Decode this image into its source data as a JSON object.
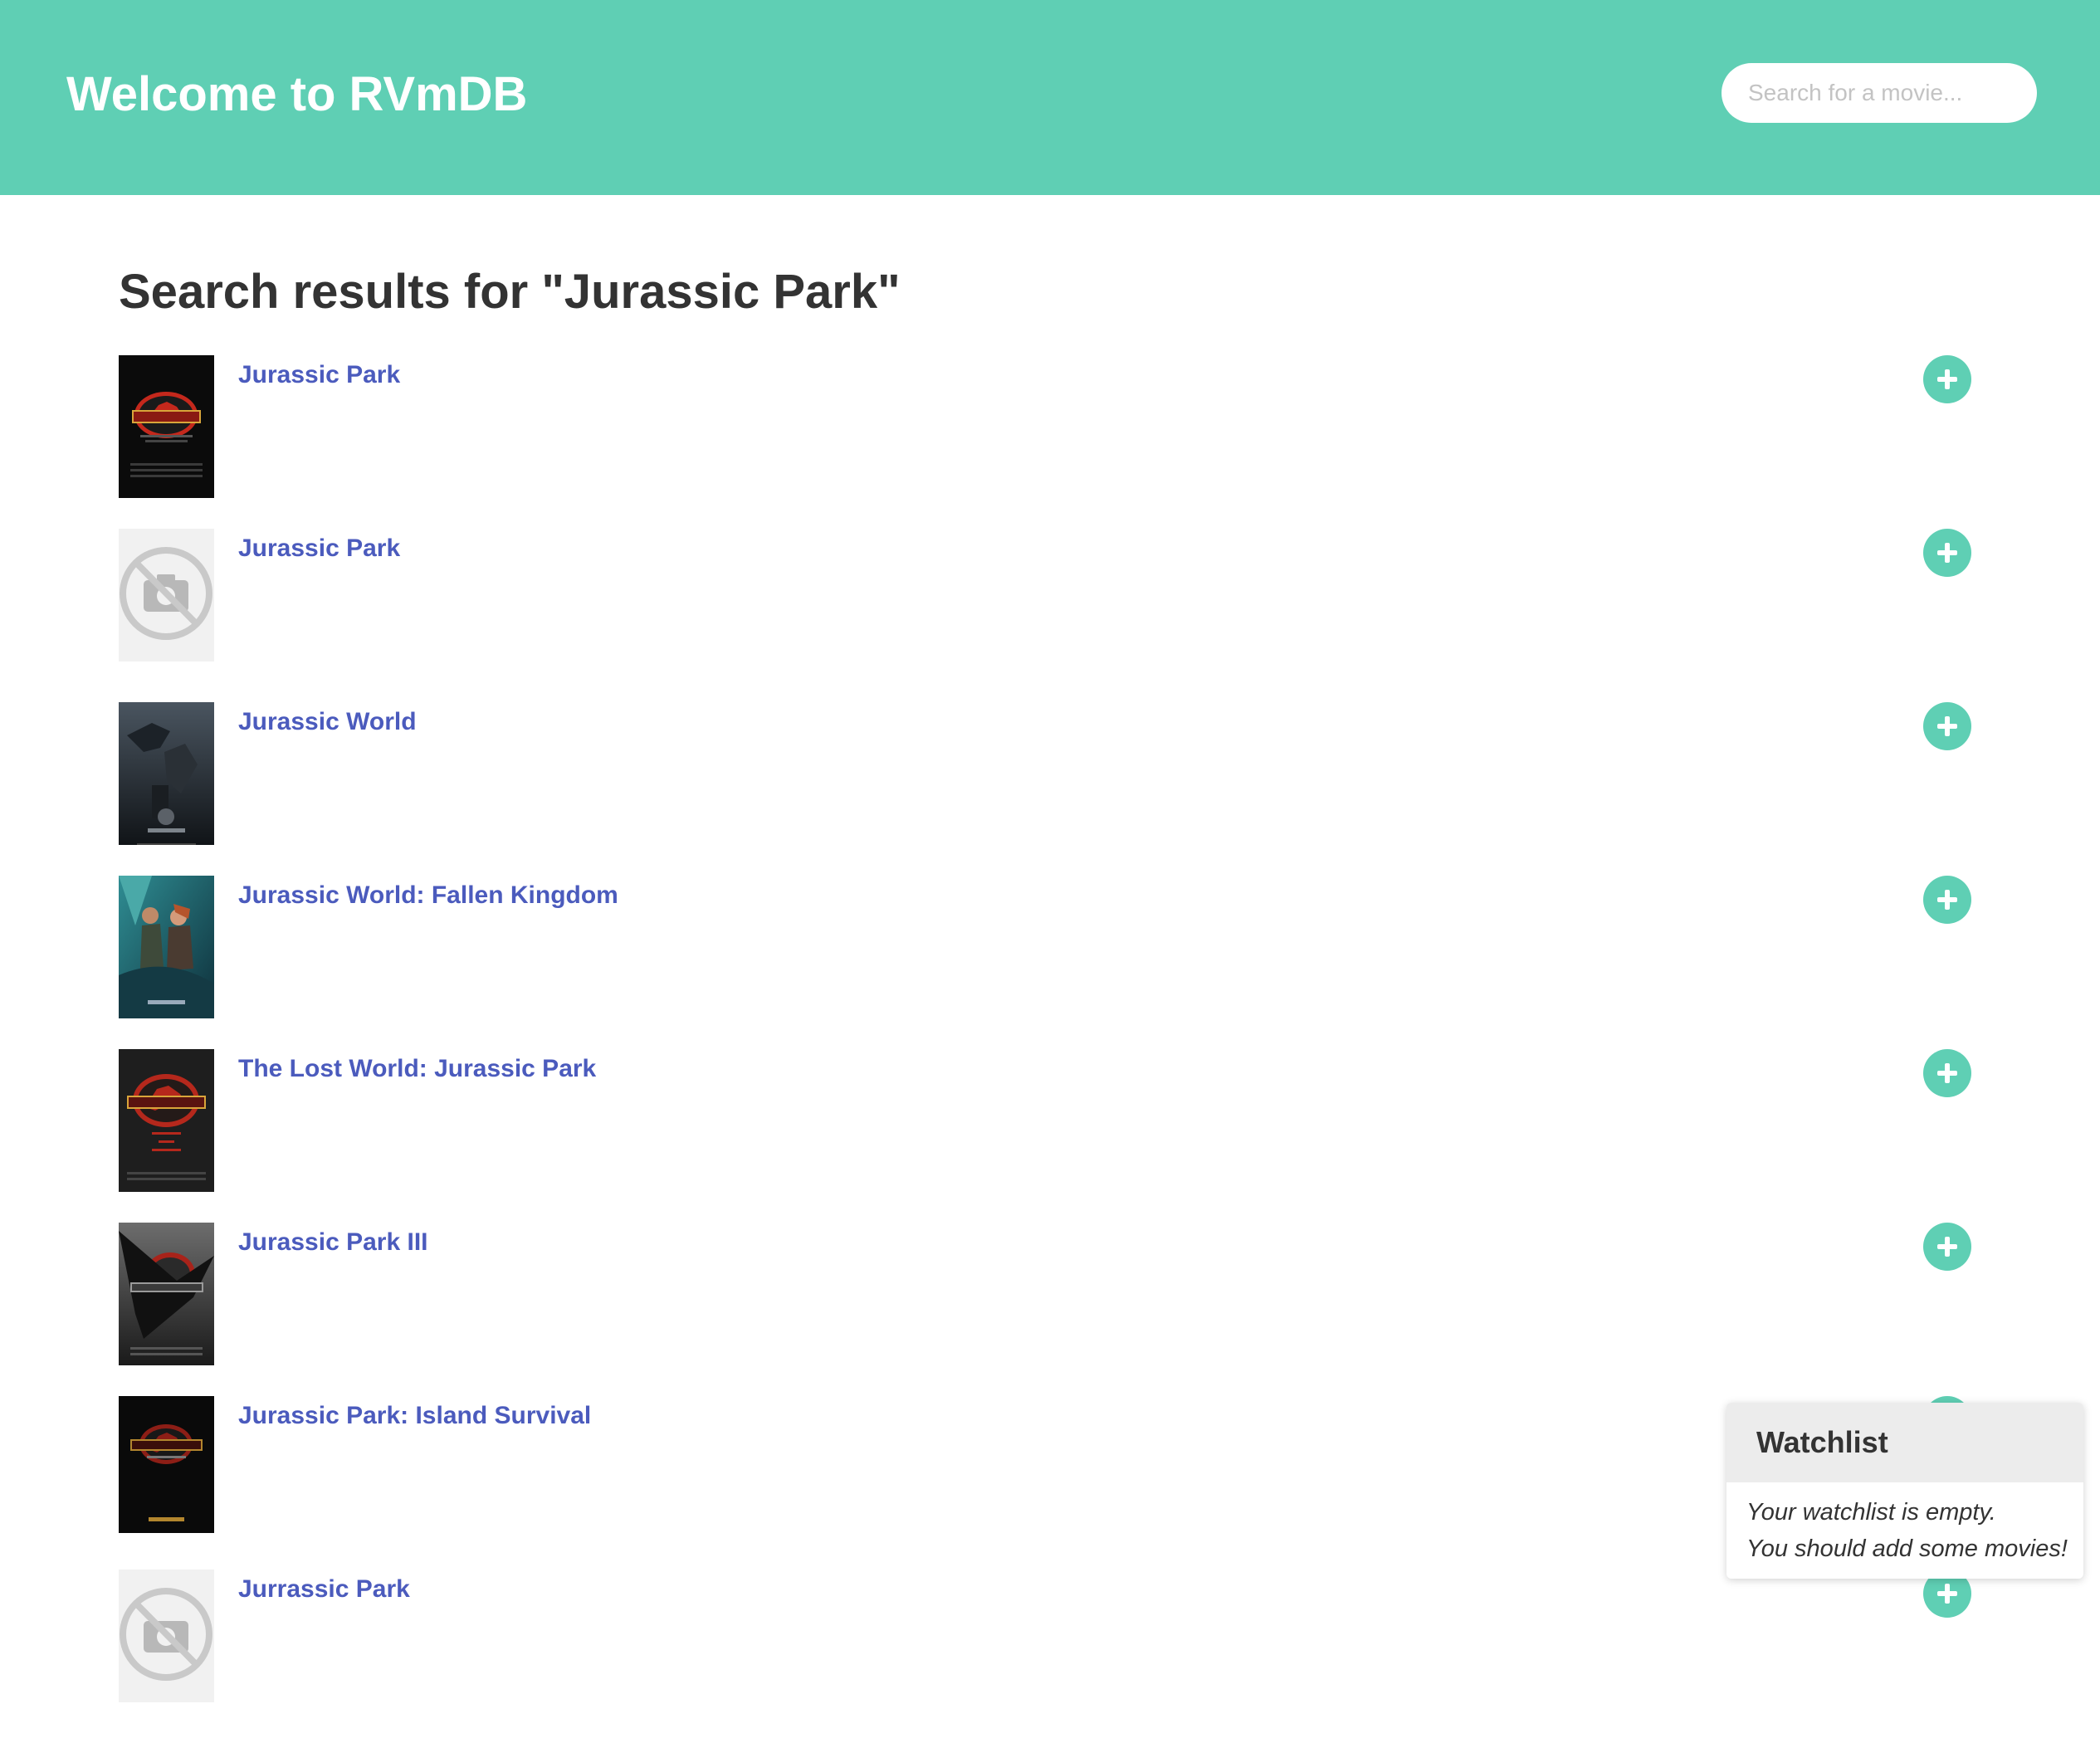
{
  "header": {
    "title": "Welcome to RVmDB",
    "search_placeholder": "Search for a movie..."
  },
  "results": {
    "heading": "Search results for \"Jurassic Park\"",
    "items": [
      {
        "title": "Jurassic Park",
        "poster": "jurassic-park-poster",
        "add_icon": "plus-icon"
      },
      {
        "title": "Jurassic Park",
        "poster": "no-image-icon",
        "add_icon": "plus-icon"
      },
      {
        "title": "Jurassic World",
        "poster": "jurassic-world-poster",
        "add_icon": "plus-icon"
      },
      {
        "title": "Jurassic World: Fallen Kingdom",
        "poster": "fallen-kingdom-poster",
        "add_icon": "plus-icon"
      },
      {
        "title": "The Lost World: Jurassic Park",
        "poster": "lost-world-poster",
        "add_icon": "plus-icon"
      },
      {
        "title": "Jurassic Park III",
        "poster": "jurassic-park-iii-poster",
        "add_icon": "plus-icon"
      },
      {
        "title": "Jurassic Park: Island Survival",
        "poster": "island-survival-poster",
        "add_icon": "plus-icon"
      },
      {
        "title": "Jurrassic Park",
        "poster": "no-image-icon",
        "add_icon": "plus-icon"
      }
    ]
  },
  "watchlist": {
    "title": "Watchlist",
    "empty_line_1": "Your watchlist is empty.",
    "empty_line_2": "You should add some movies!"
  },
  "colors": {
    "brand": "#5fcfb4",
    "link": "#4b5bbd",
    "heading_text": "#333333",
    "panel_header": "#ececec"
  }
}
